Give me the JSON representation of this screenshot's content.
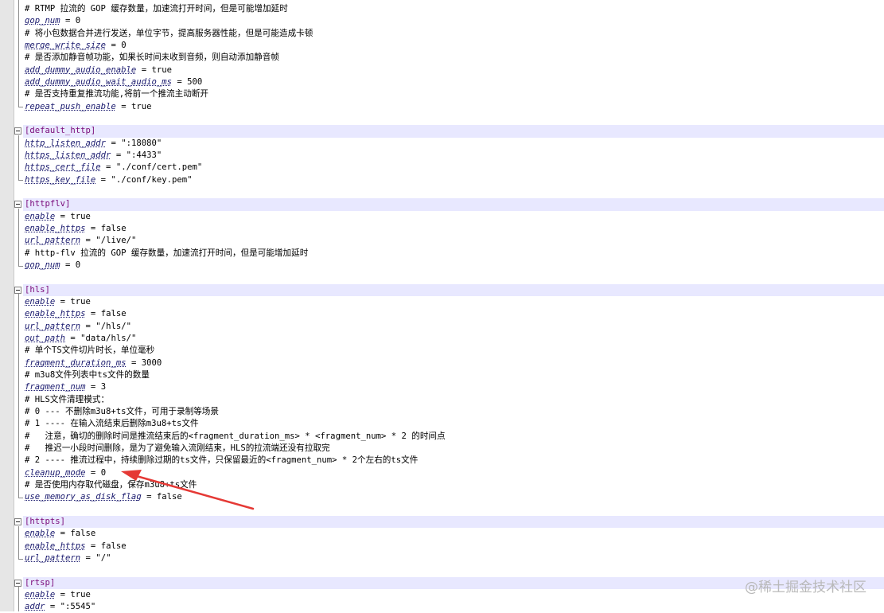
{
  "editor": {
    "lines": [
      {
        "type": "comment",
        "text": "# RTMP 拉流的 GOP 缓存数量，加速流打开时间，但是可能增加延时"
      },
      {
        "type": "kv",
        "key": "gop_num",
        "value": "0"
      },
      {
        "type": "comment",
        "text": "# 将小包数据合并进行发送，单位字节，提高服务器性能，但是可能造成卡顿"
      },
      {
        "type": "kv",
        "key": "merge_write_size",
        "value": "0"
      },
      {
        "type": "comment",
        "text": "# 是否添加静音帧功能，如果长时间未收到音频，则自动添加静音帧"
      },
      {
        "type": "kv",
        "key": "add_dummy_audio_enable",
        "value": "true"
      },
      {
        "type": "kv",
        "key": "add_dummy_audio_wait_audio_ms",
        "value": "500"
      },
      {
        "type": "comment",
        "text": "# 是否支持重复推流功能,将前一个推流主动断开"
      },
      {
        "type": "kv",
        "key": "repeat_push_enable",
        "value": "true"
      },
      {
        "type": "blank"
      },
      {
        "type": "section",
        "text": "[default_http]"
      },
      {
        "type": "kv",
        "key": "http_listen_addr",
        "value": "\":18080\""
      },
      {
        "type": "kv",
        "key": "https_listen_addr",
        "value": "\":4433\""
      },
      {
        "type": "kv",
        "key": "https_cert_file",
        "value": "\"./conf/cert.pem\""
      },
      {
        "type": "kv",
        "key": "https_key_file",
        "value": "\"./conf/key.pem\""
      },
      {
        "type": "blank"
      },
      {
        "type": "section",
        "text": "[httpflv]"
      },
      {
        "type": "kv",
        "key": "enable",
        "value": "true"
      },
      {
        "type": "kv",
        "key": "enable_https",
        "value": "false"
      },
      {
        "type": "kv",
        "key": "url_pattern",
        "value": "\"/live/\""
      },
      {
        "type": "comment",
        "text": "# http-flv 拉流的 GOP 缓存数量，加速流打开时间，但是可能增加延时"
      },
      {
        "type": "kv",
        "key": "gop_num",
        "value": "0"
      },
      {
        "type": "blank"
      },
      {
        "type": "section",
        "text": "[hls]"
      },
      {
        "type": "kv",
        "key": "enable",
        "value": "true"
      },
      {
        "type": "kv",
        "key": "enable_https",
        "value": "false"
      },
      {
        "type": "kv",
        "key": "url_pattern",
        "value": "\"/hls/\""
      },
      {
        "type": "kv",
        "key": "out_path",
        "value": "\"data/hls/\""
      },
      {
        "type": "comment",
        "text": "# 单个TS文件切片时长，单位毫秒"
      },
      {
        "type": "kv",
        "key": "fragment_duration_ms",
        "value": "3000"
      },
      {
        "type": "comment",
        "text": "# m3u8文件列表中ts文件的数量"
      },
      {
        "type": "kv",
        "key": "fragment_num",
        "value": "3"
      },
      {
        "type": "comment",
        "text": "# HLS文件清理模式："
      },
      {
        "type": "comment",
        "text": "# 0 --- 不删除m3u8+ts文件，可用于录制等场景"
      },
      {
        "type": "comment",
        "text": "# 1 ---- 在输入流结束后删除m3u8+ts文件"
      },
      {
        "type": "comment",
        "text": "#   注意，确切的删除时间是推流结束后的<fragment_duration_ms> * <fragment_num> * 2 的时间点"
      },
      {
        "type": "comment",
        "text": "#   推迟一小段时间删除，是为了避免输入流刚结束，HLS的拉流端还没有拉取完"
      },
      {
        "type": "comment",
        "text": "# 2 ---- 推流过程中，持续删除过期的ts文件，只保留最近的<fragment_num> * 2个左右的ts文件"
      },
      {
        "type": "kv",
        "key": "cleanup_mode",
        "value": "0"
      },
      {
        "type": "comment",
        "text": "# 是否使用内存取代磁盘，保存m3u8+ts文件"
      },
      {
        "type": "kv",
        "key": "use_memory_as_disk_flag",
        "value": "false"
      },
      {
        "type": "blank"
      },
      {
        "type": "section",
        "text": "[httpts]"
      },
      {
        "type": "kv",
        "key": "enable",
        "value": "false"
      },
      {
        "type": "kv",
        "key": "enable_https",
        "value": "false"
      },
      {
        "type": "kv",
        "key": "url_pattern",
        "value": "\"/\""
      },
      {
        "type": "blank"
      },
      {
        "type": "section",
        "text": "[rtsp]"
      },
      {
        "type": "kv",
        "key": "enable",
        "value": "true"
      },
      {
        "type": "kv",
        "key": "addr",
        "value": "\":5545\""
      }
    ]
  },
  "annotation": {
    "arrow_color": "#e53935",
    "target_key": "cleanup_mode"
  },
  "watermark": "@稀土掘金技术社区"
}
